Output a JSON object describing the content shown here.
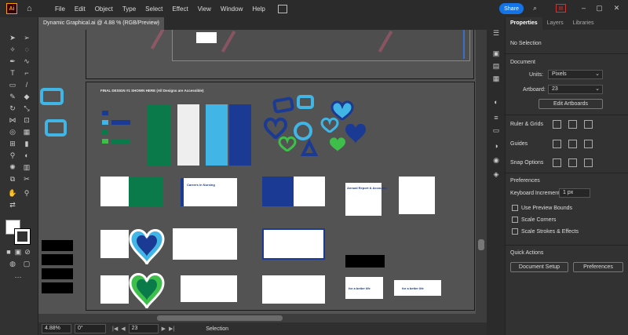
{
  "menubar": {
    "app_logo": "Ai",
    "menus": [
      "File",
      "Edit",
      "Object",
      "Type",
      "Select",
      "Effect",
      "View",
      "Window",
      "Help"
    ],
    "share_label": "Share"
  },
  "document": {
    "tab_title": "Dynamic Graphical.ai @ 4.88 % (RGB/Preview)",
    "close": "×",
    "artboard_heading": "FINAL DESIGN #1 SHOWN HERE (All Designs are Accessible)",
    "card_heading": "Careers in Nursing",
    "report_heading": "Annual Report & Accounts",
    "logo_text": "for a better life"
  },
  "status": {
    "zoom": "4.88%",
    "rotation": "0°",
    "artboard_number": "23",
    "tool": "Selection"
  },
  "panel": {
    "tabs": [
      "Properties",
      "Layers",
      "Libraries"
    ],
    "selection": "No Selection",
    "document_section": "Document",
    "units_label": "Units:",
    "units_value": "Pixels",
    "artboard_label": "Artboard:",
    "artboard_value": "23",
    "edit_artboards": "Edit Artboards",
    "rulers_grids": "Ruler & Grids",
    "guides": "Guides",
    "snap_options": "Snap Options",
    "preferences_section": "Preferences",
    "keyboard_increment_label": "Keyboard Increment:",
    "keyboard_increment_value": "1 px",
    "use_preview_bounds": "Use Preview Bounds",
    "scale_corners": "Scale Corners",
    "scale_strokes": "Scale Strokes & Effects",
    "quick_actions": "Quick Actions",
    "document_setup": "Document Setup",
    "preferences_button": "Preferences"
  },
  "colors": {
    "green": "#0b7a4b",
    "light_blue": "#41b6e6",
    "navy": "#1b3a93",
    "bright_green": "#3ebf4a",
    "accent_blue": "#1473e6",
    "orange": "#ff9a00"
  }
}
